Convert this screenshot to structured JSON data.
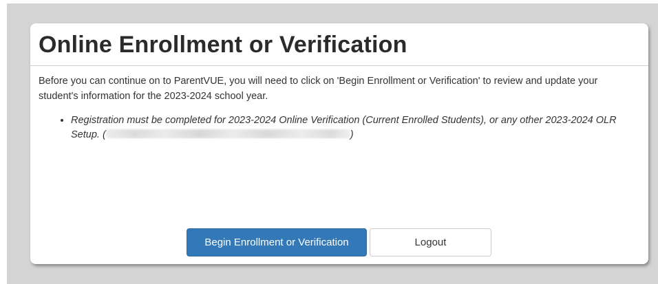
{
  "panel": {
    "title": "Online Enrollment or Verification",
    "intro": "Before you can continue on to ParentVUE, you will need to click on 'Begin Enrollment or Verification' to review and update your student's information for the 2023-2024 school year.",
    "requirement": {
      "text": "Registration must be completed for 2023-2024 Online Verification (Current Enrolled Students), or any other 2023-2024 OLR Setup.",
      "open_paren": "(",
      "close_paren": ")"
    }
  },
  "actions": {
    "begin_label": "Begin Enrollment or Verification",
    "logout_label": "Logout"
  },
  "colors": {
    "primary_button": "#3379b7",
    "page_backdrop": "#d4d4d4"
  }
}
